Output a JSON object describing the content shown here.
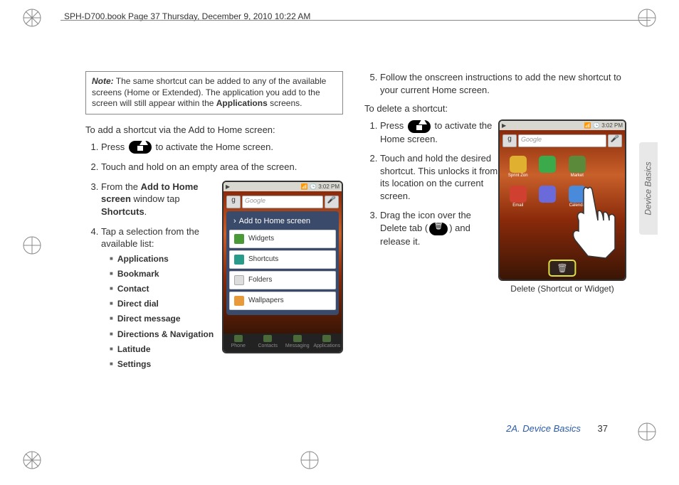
{
  "header": "SPH-D700.book  Page 37  Thursday, December 9, 2010  10:22 AM",
  "note": {
    "label": "Note:",
    "body_prefix": "The same shortcut can be added to any of the available screens (Home or Extended). The application you add to the screen will still appear within the ",
    "body_bold": "Applications",
    "body_suffix": " screens."
  },
  "col1": {
    "heading": "To add a shortcut via the Add to Home screen:",
    "step1_a": "Press ",
    "step1_b": " to activate the Home screen.",
    "step2": "Touch and hold on an empty area of the screen.",
    "step3_a": "From the ",
    "step3_b1": "Add to Home screen",
    "step3_c": " window tap ",
    "step3_b2": "Shortcuts",
    "step3_d": ".",
    "step4": "Tap a selection from the available list:",
    "bullets": [
      "Applications",
      "Bookmark",
      "Contact",
      "Direct dial",
      "Direct message",
      "Directions & Navigation",
      "Latitude",
      "Settings"
    ],
    "phone": {
      "status_left": "▶",
      "status_right": "📶 🕒 3:02 PM",
      "search_placeholder": "Google",
      "menu_title": "Add to Home screen",
      "menu_items": [
        "Widgets",
        "Shortcuts",
        "Folders",
        "Wallpapers"
      ],
      "dock": [
        "Phone",
        "Contacts",
        "Messaging",
        "Applications"
      ]
    }
  },
  "col2": {
    "step5": "Follow the onscreen instructions to add the new shortcut to your current Home screen.",
    "heading": "To delete a shortcut:",
    "step1_a": "Press ",
    "step1_b": " to activate the Home screen.",
    "step2": "Touch and hold the desired shortcut. This unlocks it from its location on the current screen.",
    "step3_a": "Drag the icon over the Delete tab (",
    "step3_b": ") and release it.",
    "phone": {
      "status_left": "▶",
      "status_right": "📶 🕒 3:02 PM",
      "search_placeholder": "Google",
      "apps": [
        {
          "label": "Sprint Zon",
          "color": "#e0b030"
        },
        {
          "label": "",
          "color": "#3aaa4a"
        },
        {
          "label": "Market",
          "color": "#5a8a3a"
        },
        {
          "label": "",
          "color": ""
        },
        {
          "label": "Email",
          "color": "#d04030"
        },
        {
          "label": "",
          "color": "#6a6adA"
        },
        {
          "label": "Calenda",
          "color": "#4a8ada"
        },
        {
          "label": "",
          "color": ""
        }
      ],
      "delete_label": "🗑"
    },
    "caption": "Delete (Shortcut or Widget)"
  },
  "footer": {
    "section": "2A. Device Basics",
    "page": "37"
  },
  "sidetab": "Device Basics"
}
